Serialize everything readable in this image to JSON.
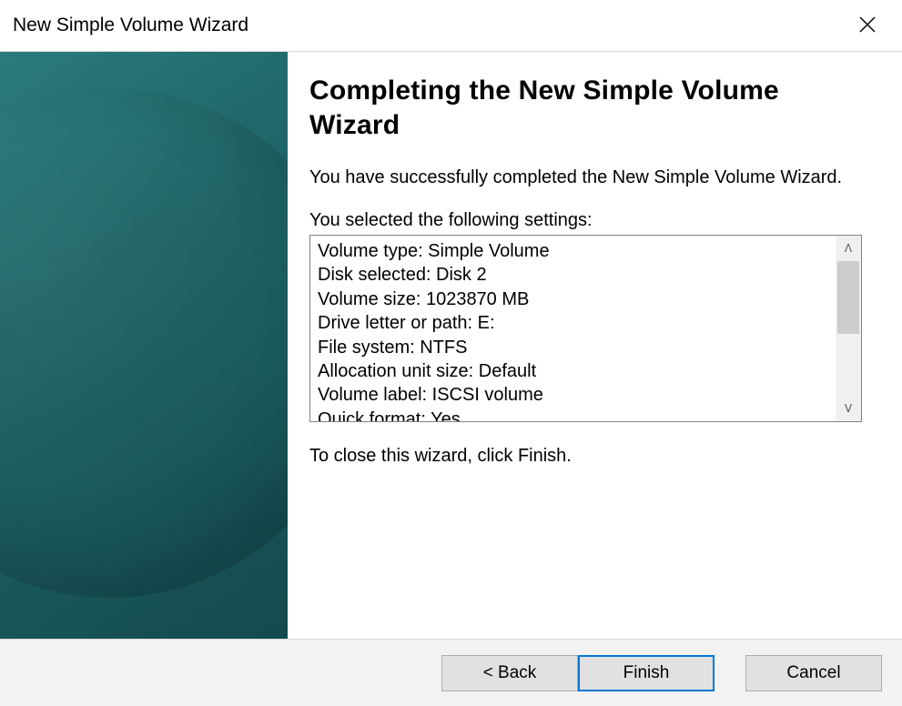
{
  "window": {
    "title": "New Simple Volume Wizard"
  },
  "page": {
    "heading": "Completing the New Simple Volume Wizard",
    "intro": "You have successfully completed the New Simple Volume Wizard.",
    "settings_label": "You selected the following settings:",
    "settings": [
      "Volume type: Simple Volume",
      "Disk selected: Disk 2",
      "Volume size: 1023870 MB",
      "Drive letter or path: E:",
      "File system: NTFS",
      "Allocation unit size: Default",
      "Volume label: ISCSI volume",
      "Quick format: Yes"
    ],
    "closing": "To close this wizard, click Finish."
  },
  "buttons": {
    "back": "< Back",
    "finish": "Finish",
    "cancel": "Cancel"
  }
}
